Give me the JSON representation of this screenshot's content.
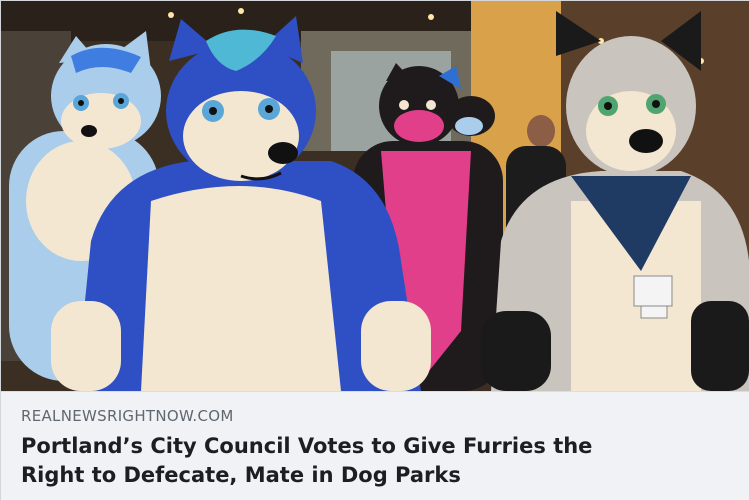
{
  "link_preview": {
    "domain": "REALNEWSRIGHTNOW.COM",
    "headline_lines": [
      "Portland’s City Council Votes to Give Furries the",
      "Right to Defecate, Mate in Dog Parks"
    ],
    "image": {
      "colors": {
        "background": "#3b2e22",
        "blue_fursuit": "#2f4fc4",
        "light_blue_fursuit": "#a9cdea",
        "black_pink_fursuit": "#1f1b1c",
        "pink": "#e23f8a",
        "gray_fursuit": "#c9c4bd",
        "navy_bandana": "#1f3a63",
        "cream": "#f3e7d2"
      }
    }
  }
}
